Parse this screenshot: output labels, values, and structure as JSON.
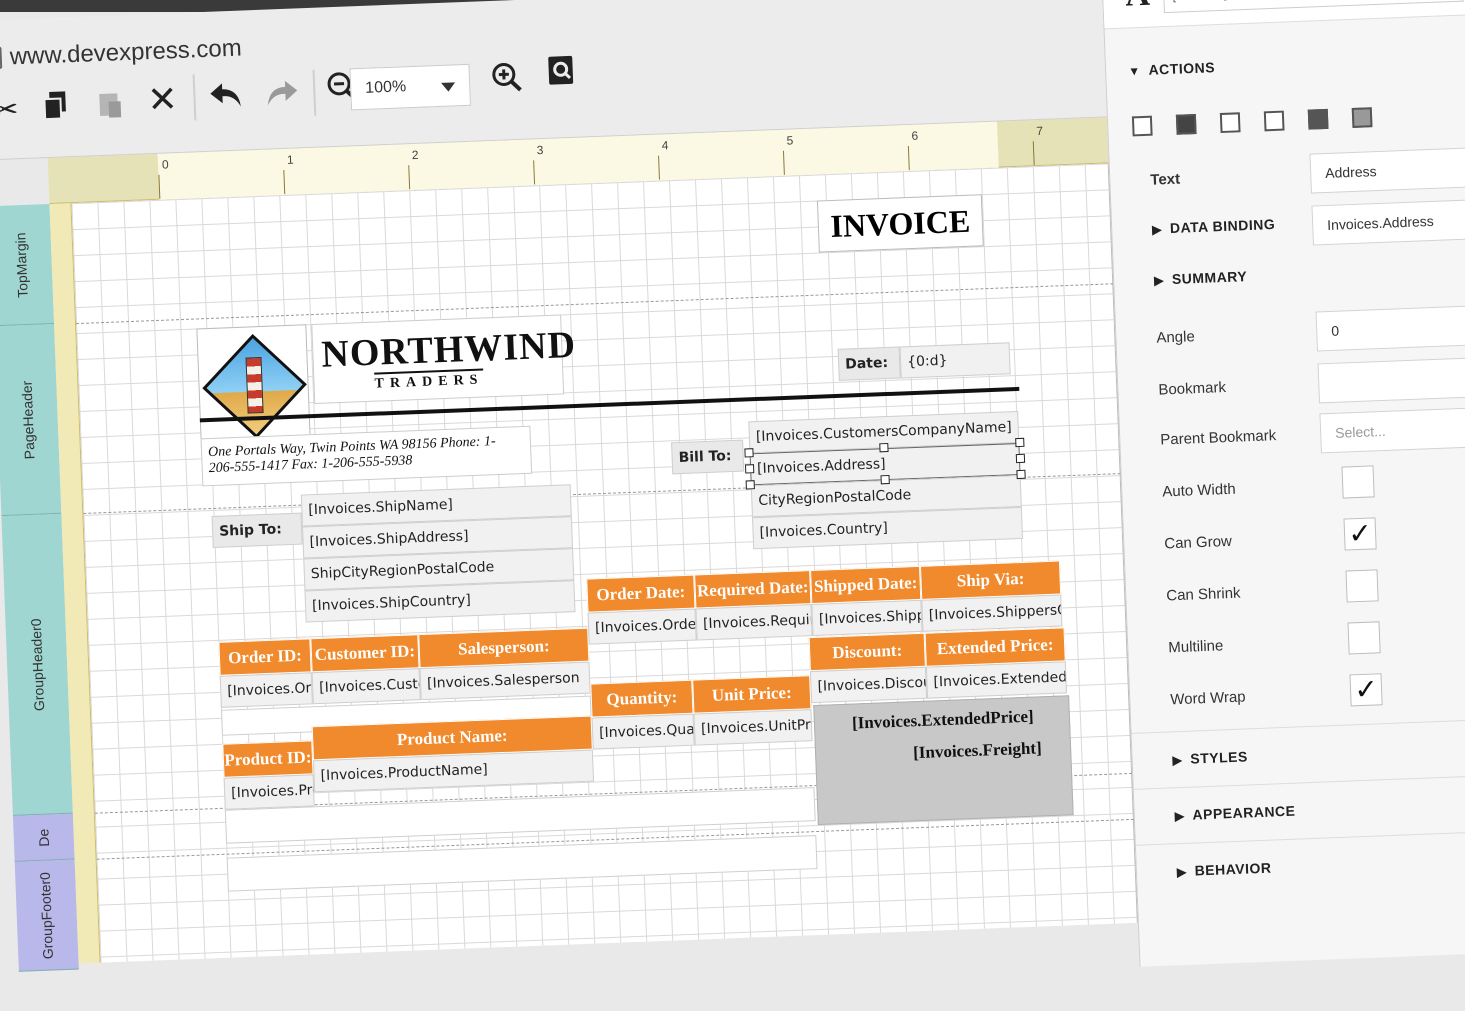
{
  "browser": {
    "url": "www.devexpress.com"
  },
  "toolbar": {
    "zoom": "100%",
    "icons": [
      "cut-icon",
      "copy-icon",
      "paste-icon",
      "delete-icon",
      "undo-icon",
      "redo-icon",
      "zoom-out-icon",
      "zoom-in-icon",
      "preview-icon"
    ]
  },
  "ruler": {
    "numbers": [
      "0",
      "1",
      "2",
      "3",
      "4",
      "5",
      "6",
      "7"
    ]
  },
  "bands": {
    "top_margin": "TopMargin",
    "page_header": "PageHeader",
    "group_header": "GroupHeader0",
    "detail": "De",
    "group_footer": "GroupFooter0"
  },
  "report": {
    "title": "INVOICE",
    "company_big": "NORTHWIND",
    "company_small": "TRADERS",
    "date_label": "Date:",
    "date_value": "{0:d}",
    "address_line1": "One Portals Way, Twin Points WA 98156 Phone: 1-",
    "address_line2": "206-555-1417 Fax: 1-206-555-5938",
    "ship_to_label": "Ship To:",
    "ship_to": [
      "[Invoices.ShipName]",
      "[Invoices.ShipAddress]",
      "ShipCityRegionPostalCode",
      "[Invoices.ShipCountry]"
    ],
    "bill_to_label": "Bill To:",
    "bill_to": [
      "[Invoices.CustomersCompanyName]",
      "[Invoices.Address]",
      "CityRegionPostalCode",
      "[Invoices.Country]"
    ],
    "order_headers": [
      "Order ID:",
      "Customer ID:",
      "Salesperson:",
      "Order Date:",
      "Required Date:",
      "Shipped Date:",
      "Ship Via:",
      "Extended Price:"
    ],
    "order_values": [
      "[Invoices.Ord",
      "[Invoices.Custo",
      "[Invoices.Salesperson",
      "[Invoices.OrderD",
      "[Invoices.Require",
      "[Invoices.Shippe",
      "[Invoices.ShippersCor",
      "[Invoices.ExtendedPric"
    ],
    "discount_header": "Discount:",
    "discount_value": "[Invoices.Discour",
    "product_headers": [
      "Product ID:",
      "Product Name:",
      "Quantity:",
      "Unit Price:"
    ],
    "product_values": [
      "[Invoices.Pro",
      "[Invoices.ProductName]",
      "[Invoices.Quantit",
      "[Invoices.UnitPric"
    ],
    "total_extended": "[Invoices.ExtendedPrice]",
    "total_freight": "[Invoices.Freight]"
  },
  "panel": {
    "top_field": "[Address]",
    "actions_label": "ACTIONS",
    "text_label": "Text",
    "text_value": "Address",
    "data_binding_label": "DATA BINDING",
    "data_binding_value": "Invoices.Address",
    "summary_label": "SUMMARY",
    "angle_label": "Angle",
    "angle_value": "0",
    "bookmark_label": "Bookmark",
    "parent_bookmark_label": "Parent Bookmark",
    "parent_bookmark_placeholder": "Select...",
    "auto_width_label": "Auto Width",
    "can_grow_label": "Can Grow",
    "can_shrink_label": "Can Shrink",
    "multiline_label": "Multiline",
    "word_wrap_label": "Word Wrap",
    "styles_label": "STYLES",
    "appearance_label": "APPEARANCE",
    "behavior_label": "BEHAVIOR",
    "checkmark": "✓",
    "checks": {
      "auto_width": false,
      "can_grow": true,
      "can_shrink": false,
      "multiline": false,
      "word_wrap": true
    }
  },
  "colors": {
    "orange_header": "#f08a2c",
    "band_teal": "#9fd6d2",
    "band_purple": "#b8b8ea",
    "ruler": "#f1e9b6"
  }
}
